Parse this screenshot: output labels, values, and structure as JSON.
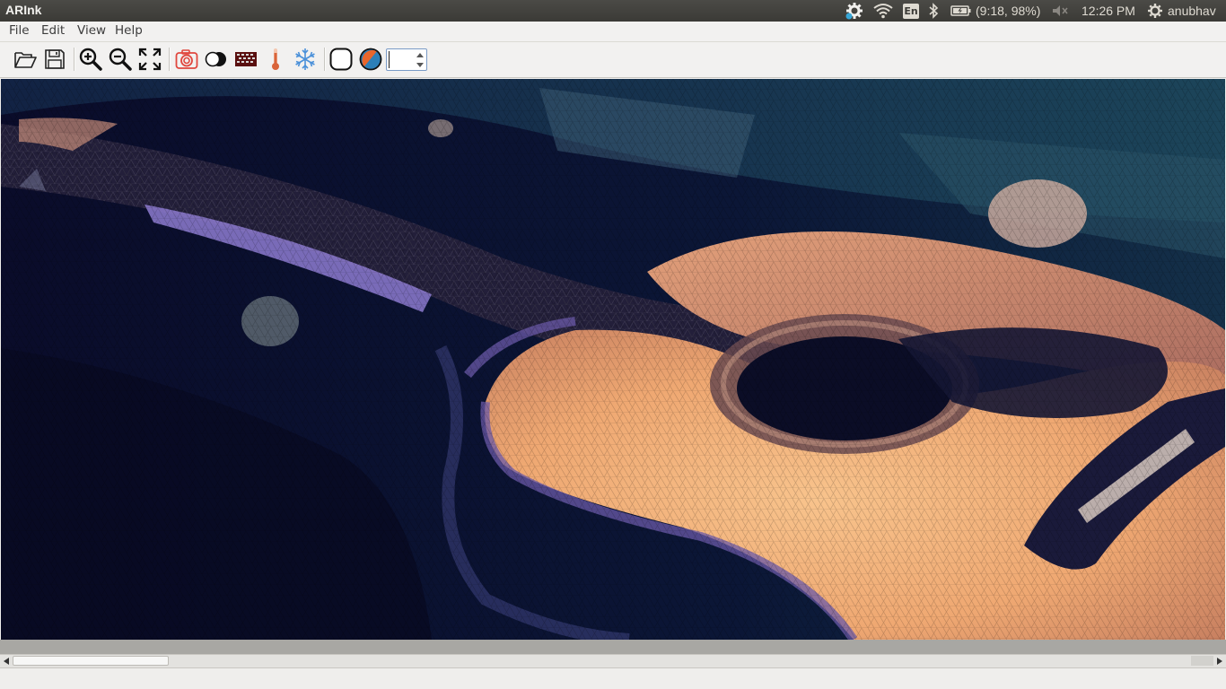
{
  "panel": {
    "app_title": "ARInk",
    "language": "En",
    "battery_text": "(9:18, 98%)",
    "clock": "12:26 PM",
    "user": "anubhav",
    "icons": [
      "settings-sync-icon",
      "wifi-icon",
      "keyboard-language-icon",
      "bluetooth-icon",
      "battery-icon",
      "volume-muted-icon",
      "power-gear-icon"
    ]
  },
  "menubar": {
    "items": [
      "File",
      "Edit",
      "View",
      "Help"
    ]
  },
  "toolbar": {
    "buttons": [
      "open-icon",
      "save-icon",
      "zoom-in-icon",
      "zoom-out-icon",
      "fit-to-window-icon",
      "camera-icon",
      "contrast-icon",
      "mosaic-pattern-icon",
      "temperature-icon",
      "snowflake-icon",
      "circle-outline-icon",
      "color-picker-icon"
    ],
    "spinbox_value": "",
    "colors": {
      "camera": "#e0473e",
      "temperature": "#d9643a",
      "snowflake": "#4a90d9",
      "color_orange": "#e8662c",
      "color_blue": "#2c7fb8"
    }
  },
  "canvas": {
    "image": "low-poly triangulated acoustic guitar body"
  }
}
